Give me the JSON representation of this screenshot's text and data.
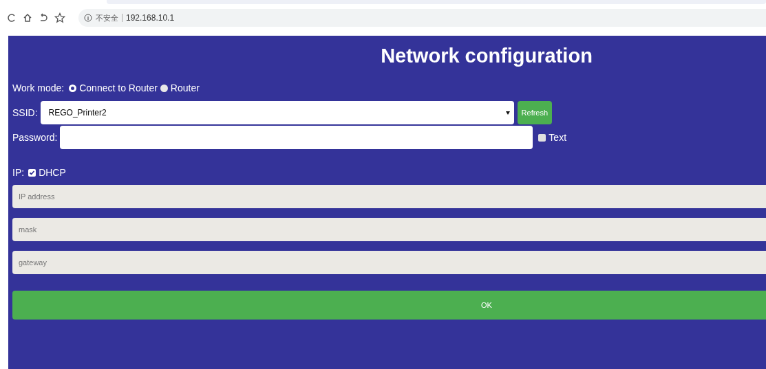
{
  "browser": {
    "security_label": "不安全",
    "url": "192.168.10.1"
  },
  "title": "Network configuration",
  "work_mode": {
    "label": "Work mode:",
    "options": [
      {
        "label": "Connect to Router",
        "selected": true
      },
      {
        "label": "Router",
        "selected": false
      }
    ]
  },
  "ssid": {
    "label": "SSID:",
    "value": "REGO_Printer2",
    "refresh_button": "Refresh"
  },
  "password": {
    "label": "Password:",
    "show_text": {
      "label": "Text",
      "checked": false
    }
  },
  "ip": {
    "label": "IP:",
    "dhcp": {
      "label": "DHCP",
      "checked": true
    }
  },
  "ip_fields": [
    {
      "placeholder": "IP address"
    },
    {
      "placeholder": "mask"
    },
    {
      "placeholder": "gateway"
    }
  ],
  "ok_button": "OK"
}
